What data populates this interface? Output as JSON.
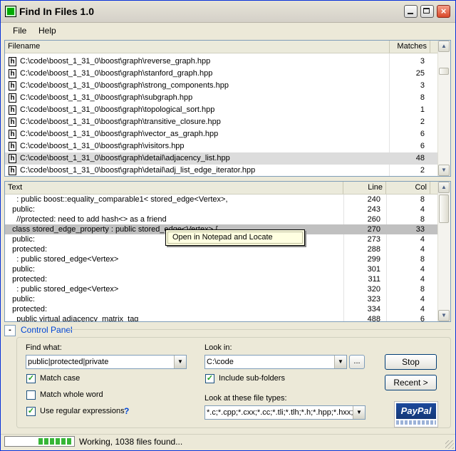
{
  "window": {
    "title": "Find In Files 1.0",
    "close_glyph": "×"
  },
  "menu": [
    "File",
    "Help"
  ],
  "file_list": {
    "headers": {
      "filename": "Filename",
      "matches": "Matches"
    },
    "rows": [
      {
        "name": "C:\\code\\boost_1_31_0\\boost\\graph\\reverse_graph.hpp",
        "matches": "3"
      },
      {
        "name": "C:\\code\\boost_1_31_0\\boost\\graph\\stanford_graph.hpp",
        "matches": "25"
      },
      {
        "name": "C:\\code\\boost_1_31_0\\boost\\graph\\strong_components.hpp",
        "matches": "3"
      },
      {
        "name": "C:\\code\\boost_1_31_0\\boost\\graph\\subgraph.hpp",
        "matches": "8"
      },
      {
        "name": "C:\\code\\boost_1_31_0\\boost\\graph\\topological_sort.hpp",
        "matches": "1"
      },
      {
        "name": "C:\\code\\boost_1_31_0\\boost\\graph\\transitive_closure.hpp",
        "matches": "2"
      },
      {
        "name": "C:\\code\\boost_1_31_0\\boost\\graph\\vector_as_graph.hpp",
        "matches": "6"
      },
      {
        "name": "C:\\code\\boost_1_31_0\\boost\\graph\\visitors.hpp",
        "matches": "6"
      },
      {
        "name": "C:\\code\\boost_1_31_0\\boost\\graph\\detail\\adjacency_list.hpp",
        "matches": "48",
        "selected": true
      },
      {
        "name": "C:\\code\\boost_1_31_0\\boost\\graph\\detail\\adj_list_edge_iterator.hpp",
        "matches": "2"
      }
    ],
    "file_icon_label": "h"
  },
  "match_list": {
    "headers": {
      "text": "Text",
      "line": "Line",
      "col": "Col"
    },
    "rows": [
      {
        "text": "    : public boost::equality_comparable1< stored_edge<Vertex>,",
        "line": "240",
        "col": "8"
      },
      {
        "text": "  public:",
        "line": "243",
        "col": "4"
      },
      {
        "text": "    //protected: need to add hash<> as a friend",
        "line": "260",
        "col": "8"
      },
      {
        "text": "  class stored_edge_property : public stored_edge<Vertex> {",
        "line": "270",
        "col": "33",
        "selected": true
      },
      {
        "text": "  public:",
        "line": "273",
        "col": "4"
      },
      {
        "text": "  protected:",
        "line": "288",
        "col": "4"
      },
      {
        "text": "    : public stored_edge<Vertex>",
        "line": "299",
        "col": "8"
      },
      {
        "text": "  public:",
        "line": "301",
        "col": "4"
      },
      {
        "text": "  protected:",
        "line": "311",
        "col": "4"
      },
      {
        "text": "    : public stored_edge<Vertex>",
        "line": "320",
        "col": "8"
      },
      {
        "text": "  public:",
        "line": "323",
        "col": "4"
      },
      {
        "text": "  protected:",
        "line": "334",
        "col": "4"
      },
      {
        "text": "    public virtual adjacency_matrix_tag",
        "line": "488",
        "col": "6"
      }
    ]
  },
  "context_menu": {
    "item": "Open in Notepad and Locate"
  },
  "control_panel": {
    "toggle": "-",
    "label": "Control Panel",
    "find_what_label": "Find what:",
    "find_what_value": "public|protected|private",
    "look_in_label": "Look in:",
    "look_in_value": "C:\\code",
    "browse_label": "...",
    "match_case_label": "Match case",
    "match_case": true,
    "match_whole_word_label": "Match whole word",
    "match_whole_word": false,
    "regex_label": "Use regular expressions",
    "regex": true,
    "regex_help": "?",
    "include_sub_label": "Include sub-folders",
    "include_sub": true,
    "file_types_label": "Look at these file types:",
    "file_types_value": "*.c;*.cpp;*.cxx;*.cc;*.tli;*.tlh;*.h;*.hpp;*.hxx;",
    "stop_label": "Stop",
    "recent_label": "Recent >",
    "paypal_label": "PayPal",
    "checkmark": "✓"
  },
  "status": {
    "text": "Working, 1038 files found...",
    "progress": 0.55
  },
  "icons": {
    "scroll_up": "▲",
    "scroll_down": "▼",
    "dropdown": "▼"
  }
}
